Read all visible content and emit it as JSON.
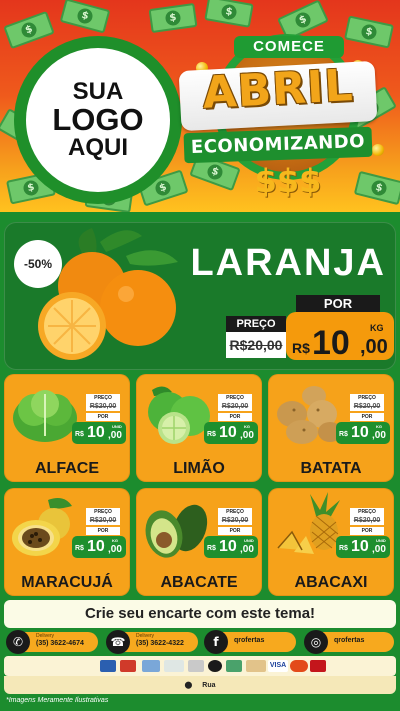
{
  "colors": {
    "header_top": "#e4361c",
    "header_bottom": "#ffc21f",
    "background_green": "#1c8c2e",
    "card_orange": "#f6a21a",
    "price_green": "#1e8f2e",
    "price_orange": "#f59a0c"
  },
  "header": {
    "logo_placeholder": {
      "line1": "SUA",
      "line2": "LOGO",
      "line3": "AQUI"
    },
    "badge": {
      "top": "COMECE",
      "main": "ABRIL",
      "bottom": "ECONOMIZANDO",
      "symbols": "$$$"
    }
  },
  "featured": {
    "discount": "-50%",
    "name": "LARANJA",
    "old_price_label": "PREÇO",
    "old_price": "R$20,00",
    "new_price_label": "POR",
    "currency": "R$",
    "price_main": "10",
    "price_cents": ",00",
    "unit": "KG",
    "image_icon": "orange-fruit-icon"
  },
  "products": [
    {
      "name": "ALFACE",
      "old_label": "PREÇO",
      "old_price": "R$20,00",
      "por_label": "POR",
      "currency": "R$",
      "price_main": "10",
      "price_cents": ",00",
      "unit": "UNID",
      "icon": "lettuce-icon"
    },
    {
      "name": "LIMÃO",
      "old_label": "PREÇO",
      "old_price": "R$20,00",
      "por_label": "POR",
      "currency": "R$",
      "price_main": "10",
      "price_cents": ",00",
      "unit": "KG",
      "icon": "lime-icon"
    },
    {
      "name": "BATATA",
      "old_label": "PREÇO",
      "old_price": "R$20,00",
      "por_label": "POR",
      "currency": "R$",
      "price_main": "10",
      "price_cents": ",00",
      "unit": "KG",
      "icon": "potato-icon"
    },
    {
      "name": "MARACUJÁ",
      "old_label": "PREÇO",
      "old_price": "R$20,00",
      "por_label": "POR",
      "currency": "R$",
      "price_main": "10",
      "price_cents": ",00",
      "unit": "KG",
      "icon": "passion-fruit-icon"
    },
    {
      "name": "ABACATE",
      "old_label": "PREÇO",
      "old_price": "R$20,00",
      "por_label": "POR",
      "currency": "R$",
      "price_main": "10",
      "price_cents": ",00",
      "unit": "UNID",
      "icon": "avocado-icon"
    },
    {
      "name": "ABACAXI",
      "old_label": "PREÇO",
      "old_price": "R$20,00",
      "por_label": "POR",
      "currency": "R$",
      "price_main": "10",
      "price_cents": ",00",
      "unit": "UNID",
      "icon": "pineapple-icon"
    }
  ],
  "banner": {
    "text": "Crie seu encarte com este tema!"
  },
  "contacts": [
    {
      "icon": "whatsapp-icon",
      "label": "Delivery",
      "value": "(35) 3622-4674"
    },
    {
      "icon": "phone-icon",
      "label": "Delivery",
      "value": "(35) 3622-4322"
    },
    {
      "icon": "facebook-icon",
      "label": "",
      "value": "qrofertas"
    },
    {
      "icon": "instagram-icon",
      "label": "",
      "value": "qrofertas"
    }
  ],
  "payment_icons": [
    "boleto-icon",
    "card-icon",
    "ticket-icon",
    "pix-icon",
    "card2-icon",
    "alelo-icon",
    "elo-icon",
    "card3-icon",
    "visa-icon",
    "mastercard-icon",
    "hipercard-icon"
  ],
  "payment_visa": "VISA",
  "address": {
    "icon": "map-pin-icon",
    "text": "Rua"
  },
  "disclaimer": "*Imagens Meramente Ilustrativas"
}
